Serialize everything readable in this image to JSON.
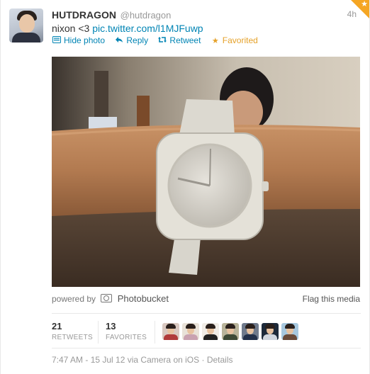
{
  "tweet": {
    "fullname": "HUTDRAGON",
    "username": "@hutdragon",
    "time": "4h",
    "text_prefix": "nixon <3",
    "link": "pic.twitter.com/l1MJFuwp"
  },
  "actions": {
    "hide_photo": "Hide photo",
    "reply": "Reply",
    "retweet": "Retweet",
    "favorited": "Favorited"
  },
  "media": {
    "powered_by": "powered by",
    "provider": "Photobucket",
    "flag": "Flag this media",
    "photo_description": "photo of a white wristwatch on an arm, person in blue hoodie in background"
  },
  "stats": {
    "retweets_count": "21",
    "retweets_label": "RETWEETS",
    "favorites_count": "13",
    "favorites_label": "FAVORITES"
  },
  "favoriters": [
    {
      "name": "favoriter-1",
      "bg": "#d9c8c0",
      "shirt": "#b03a3a"
    },
    {
      "name": "favoriter-2",
      "bg": "#e9e2d8",
      "shirt": "#c9a2b0"
    },
    {
      "name": "favoriter-3",
      "bg": "#f0ece6",
      "shirt": "#222222"
    },
    {
      "name": "favoriter-4",
      "bg": "#b9b49a",
      "shirt": "#3e4a36"
    },
    {
      "name": "favoriter-5",
      "bg": "#6f7a8c",
      "shirt": "#22304a"
    },
    {
      "name": "favoriter-6",
      "bg": "#1d2a3a",
      "shirt": "#d0d6de"
    },
    {
      "name": "favoriter-7",
      "bg": "#a7c8df",
      "shirt": "#6a4b3a"
    }
  ],
  "meta": {
    "timestamp": "7:47 AM - 15 Jul 12",
    "via": "via Camera on iOS",
    "details": "Details"
  },
  "colors": {
    "link": "#0084b4",
    "favorite": "#e5a129",
    "muted": "#999999"
  }
}
